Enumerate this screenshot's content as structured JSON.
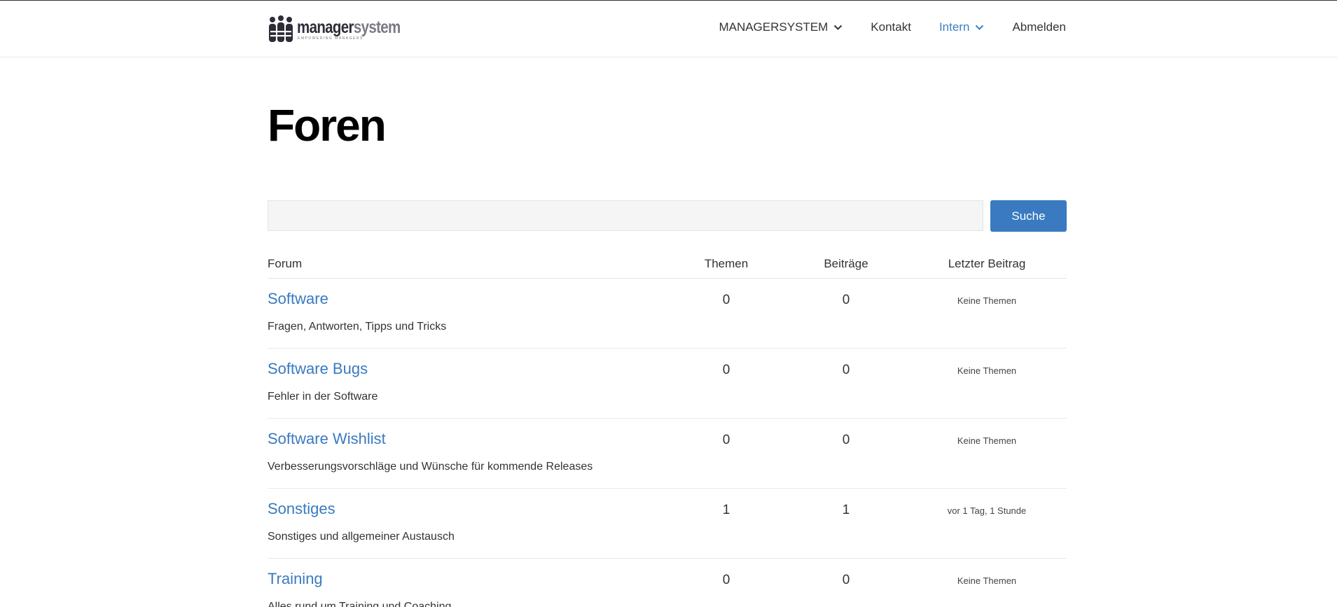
{
  "header": {
    "logo": {
      "word_part1": "manager",
      "word_part2": "system",
      "tagline": "EMPOWERING MANAGERS"
    },
    "nav": [
      {
        "label": "MANAGERSYSTEM",
        "dropdown": true
      },
      {
        "label": "Kontakt"
      },
      {
        "label": "Intern",
        "dropdown": true,
        "active": true
      },
      {
        "label": "Abmelden"
      }
    ]
  },
  "main": {
    "title": "Foren",
    "search": {
      "value": "",
      "button_label": "Suche"
    },
    "table": {
      "headers": {
        "forum": "Forum",
        "themen": "Themen",
        "beitraege": "Beiträge",
        "letzter": "Letzter Beitrag"
      },
      "rows": [
        {
          "title": "Software",
          "description": "Fragen, Antworten, Tipps und Tricks",
          "themen": "0",
          "beitraege": "0",
          "letzter": "Keine Themen"
        },
        {
          "title": "Software Bugs",
          "description": "Fehler in der Software",
          "themen": "0",
          "beitraege": "0",
          "letzter": "Keine Themen"
        },
        {
          "title": "Software Wishlist",
          "description": "Verbesserungsvorschläge und Wünsche für kommende Releases",
          "themen": "0",
          "beitraege": "0",
          "letzter": "Keine Themen"
        },
        {
          "title": "Sonstiges",
          "description": "Sonstiges und allgemeiner Austausch",
          "themen": "1",
          "beitraege": "1",
          "letzter": "vor 1 Tag, 1 Stunde"
        },
        {
          "title": "Training",
          "description": "Alles rund um Training und Coaching",
          "themen": "0",
          "beitraege": "0",
          "letzter": "Keine Themen"
        }
      ]
    }
  },
  "colors": {
    "accent": "#3a7ac0",
    "nav_active": "#3a7fc1",
    "title": "#000000",
    "search_bg": "#f5f5f5"
  },
  "icons": {
    "logo": "people-logo-icon",
    "dropdown": "chevron-down-icon"
  }
}
